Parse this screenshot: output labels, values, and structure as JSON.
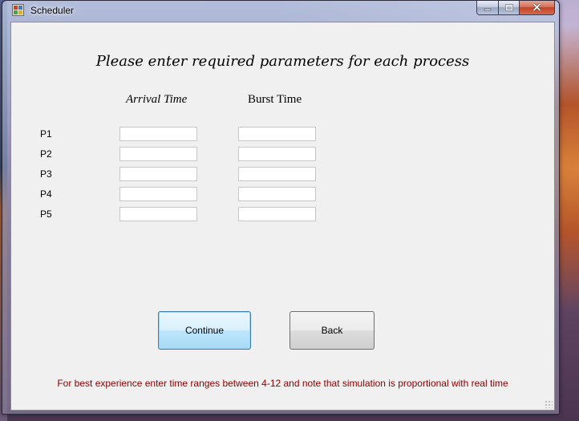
{
  "window": {
    "title": "Scheduler",
    "icon": "scheduler-app-icon"
  },
  "caption_buttons": {
    "minimize": "minimize-icon",
    "maximize": "maximize-icon",
    "close": "close-icon"
  },
  "form": {
    "heading": "Please enter required parameters for each process",
    "columns": {
      "arrival": "Arrival Time",
      "burst": "Burst Time"
    },
    "processes": [
      {
        "label": "P1",
        "arrival": "",
        "burst": ""
      },
      {
        "label": "P2",
        "arrival": "",
        "burst": ""
      },
      {
        "label": "P3",
        "arrival": "",
        "burst": ""
      },
      {
        "label": "P4",
        "arrival": "",
        "burst": ""
      },
      {
        "label": "P5",
        "arrival": "",
        "burst": ""
      }
    ],
    "buttons": {
      "continue": "Continue",
      "back": "Back"
    },
    "note": "For best experience enter time ranges between 4-12 and note that simulation is proportional with real time"
  },
  "colors": {
    "note_text": "#8b0000",
    "client_bg": "#f0f0f0",
    "focused_button_border": "#3c7fb1"
  }
}
